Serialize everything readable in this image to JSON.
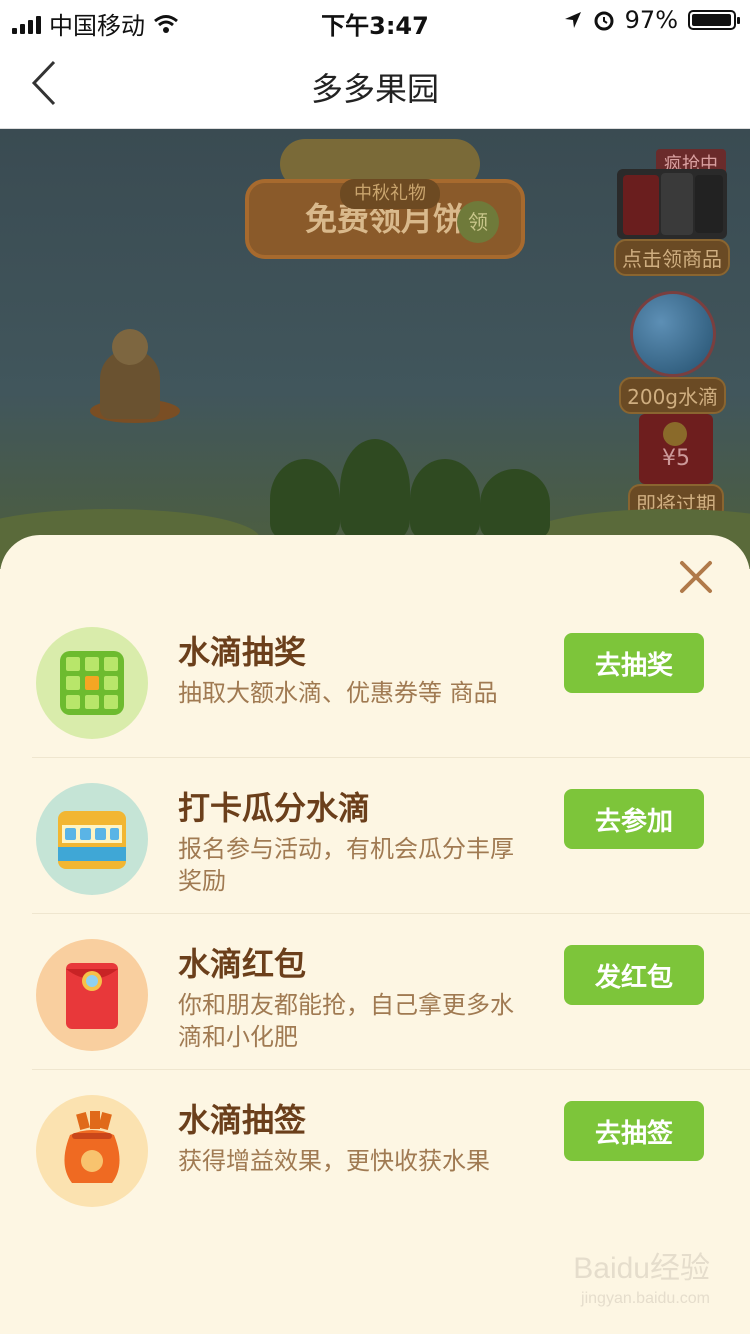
{
  "status_bar": {
    "carrier": "中国移动",
    "time": "下午3:47",
    "battery_percent": "97%",
    "battery_level": 0.97
  },
  "nav": {
    "title": "多多果园",
    "back_icon": "chevron-left-icon"
  },
  "game": {
    "banner_sub": "中秋礼物",
    "banner_title": "免费领月饼",
    "banner_badge": "领",
    "side": [
      {
        "tag": "疯抢中",
        "label": "点击领商品"
      },
      {
        "label": "200g水滴"
      },
      {
        "amount": "¥5",
        "label": "即将过期"
      }
    ]
  },
  "sheet": {
    "close_icon": "close-icon",
    "tasks": [
      {
        "title": "水滴抽奖",
        "desc": "抽取大额水滴、优惠券等 商品",
        "button": "去抽奖",
        "icon_color": "#d9ecab"
      },
      {
        "title": "打卡瓜分水滴",
        "desc": "报名参与活动，有机会瓜分丰厚奖励",
        "button": "去参加",
        "icon_color": "#c5e4d6"
      },
      {
        "title": "水滴红包",
        "desc": "你和朋友都能抢，自己拿更多水滴和小化肥",
        "button": "发红包",
        "icon_color": "#f9cf9f"
      },
      {
        "title": "水滴抽签",
        "desc": "获得增益效果，更快收获水果",
        "button": "去抽签",
        "icon_color": "#fbe2b0"
      }
    ]
  },
  "watermark": {
    "main": "Baidu经验",
    "sub": "jingyan.baidu.com"
  }
}
